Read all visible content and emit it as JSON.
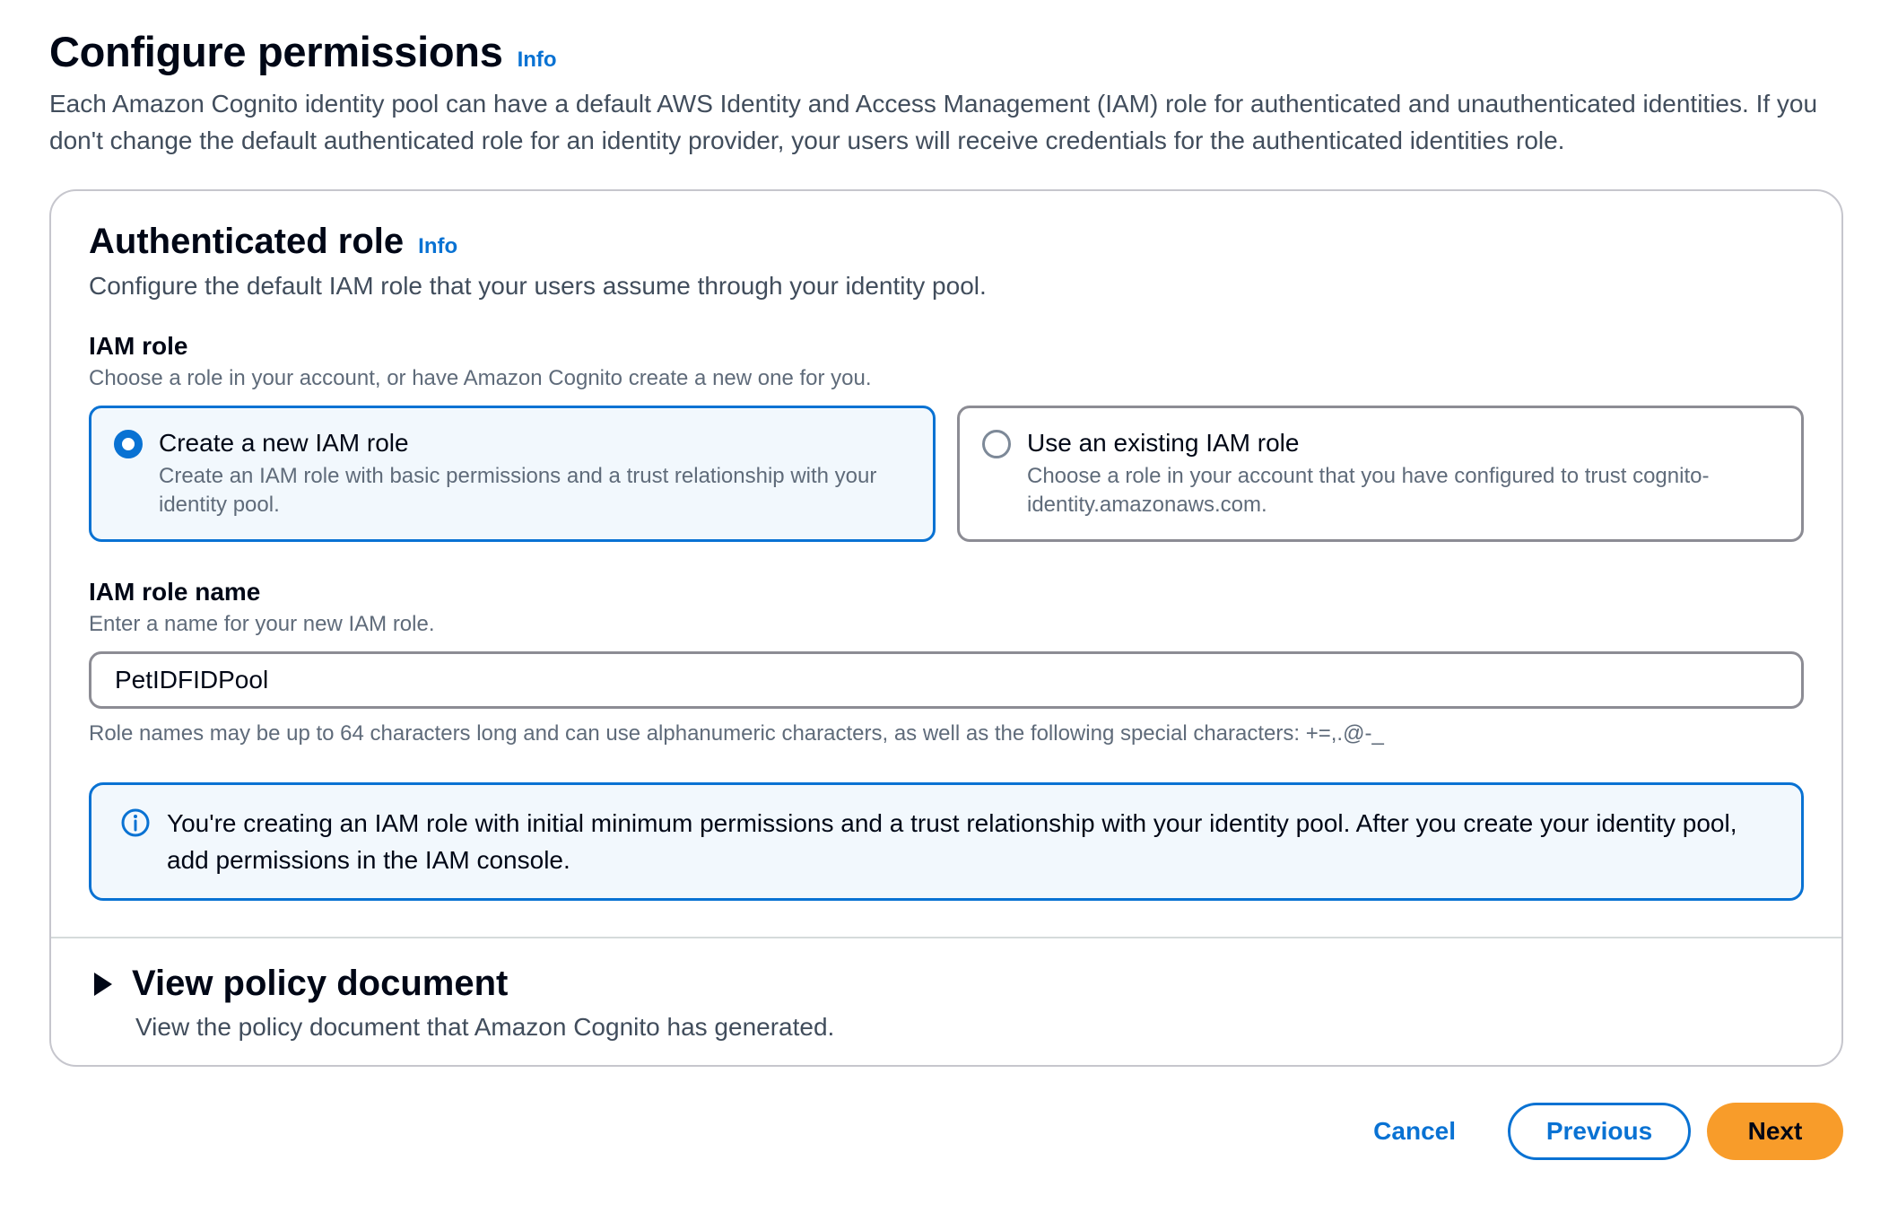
{
  "page": {
    "title": "Configure permissions",
    "info_label": "Info",
    "description": "Each Amazon Cognito identity pool can have a default AWS Identity and Access Management (IAM) role for authenticated and unauthenticated identities. If you don't change the default authenticated role for an identity provider, your users will receive credentials for the authenticated identities role."
  },
  "authenticated_role": {
    "title": "Authenticated role",
    "info_label": "Info",
    "description": "Configure the default IAM role that your users assume through your identity pool.",
    "iam_role": {
      "label": "IAM role",
      "description": "Choose a role in your account, or have Amazon Cognito create a new one for you.",
      "options": [
        {
          "label": "Create a new IAM role",
          "description": "Create an IAM role with basic permissions and a trust relationship with your identity pool.",
          "selected": true
        },
        {
          "label": "Use an existing IAM role",
          "description": "Choose a role in your account that you have configured to trust cognito-identity.amazonaws.com.",
          "selected": false
        }
      ]
    },
    "iam_role_name": {
      "label": "IAM role name",
      "description": "Enter a name for your new IAM role.",
      "value": "PetIDFIDPool",
      "constraint": "Role names may be up to 64 characters long and can use alphanumeric characters, as well as the following special characters: +=,.@-_"
    },
    "alert": {
      "icon": "info-icon",
      "text": "You're creating an IAM role with initial minimum permissions and a trust relationship with your identity pool. After you create your identity pool, add permissions in the IAM console."
    }
  },
  "policy_document": {
    "title": "View policy document",
    "description": "View the policy document that Amazon Cognito has generated.",
    "expanded": false
  },
  "actions": {
    "cancel_label": "Cancel",
    "previous_label": "Previous",
    "next_label": "Next"
  },
  "colors": {
    "accent": "#0972d3",
    "primary_button": "#f89c2a",
    "selected_tile_bg": "#f2f8fd"
  }
}
